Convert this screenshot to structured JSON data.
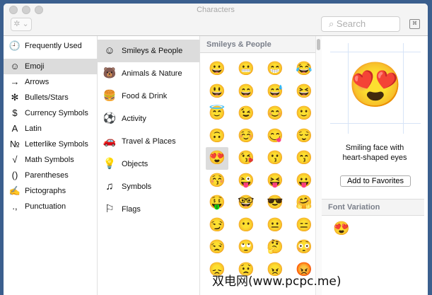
{
  "window": {
    "title": "Characters",
    "search_placeholder": "Search",
    "gear_label": "✲ ⌄",
    "keyboard_icon": "⌘"
  },
  "categories": [
    {
      "label": "Frequently Used",
      "icon": "🕘"
    },
    {
      "label": "Emoji",
      "icon": "☺"
    },
    {
      "label": "Arrows",
      "icon": "→"
    },
    {
      "label": "Bullets/Stars",
      "icon": "✻"
    },
    {
      "label": "Currency Symbols",
      "icon": "$"
    },
    {
      "label": "Latin",
      "icon": "A"
    },
    {
      "label": "Letterlike Symbols",
      "icon": "№"
    },
    {
      "label": "Math Symbols",
      "icon": "√"
    },
    {
      "label": "Parentheses",
      "icon": "()"
    },
    {
      "label": "Pictographs",
      "icon": "✍"
    },
    {
      "label": "Punctuation",
      "icon": ".,"
    }
  ],
  "subcategories": [
    {
      "label": "Smileys & People",
      "icon": "☺"
    },
    {
      "label": "Animals & Nature",
      "icon": "🐻"
    },
    {
      "label": "Food & Drink",
      "icon": "🍔"
    },
    {
      "label": "Activity",
      "icon": "⚽"
    },
    {
      "label": "Travel & Places",
      "icon": "🚗"
    },
    {
      "label": "Objects",
      "icon": "💡"
    },
    {
      "label": "Symbols",
      "icon": "♫"
    },
    {
      "label": "Flags",
      "icon": "⚐"
    }
  ],
  "grid": {
    "header": "Smileys & People",
    "selected_index": 16,
    "emoji": [
      "😀",
      "😬",
      "😁",
      "😂",
      "😃",
      "😄",
      "😅",
      "😆",
      "😇",
      "😉",
      "😊",
      "🙂",
      "🙃",
      "☺️",
      "😋",
      "😌",
      "😍",
      "😘",
      "😗",
      "😙",
      "😚",
      "😜",
      "😝",
      "😛",
      "🤑",
      "🤓",
      "😎",
      "🤗",
      "😏",
      "😶",
      "😐",
      "😑",
      "😒",
      "🙄",
      "🤔",
      "😳",
      "😞",
      "😟",
      "😠",
      "😡"
    ]
  },
  "detail": {
    "glyph": "😍",
    "name_line1": "Smiling face with",
    "name_line2": "heart-shaped eyes",
    "add_favorites": "Add to Favorites",
    "font_variation_header": "Font Variation",
    "variation": "😍"
  },
  "watermark": "双电网(www.pcpc.me)"
}
